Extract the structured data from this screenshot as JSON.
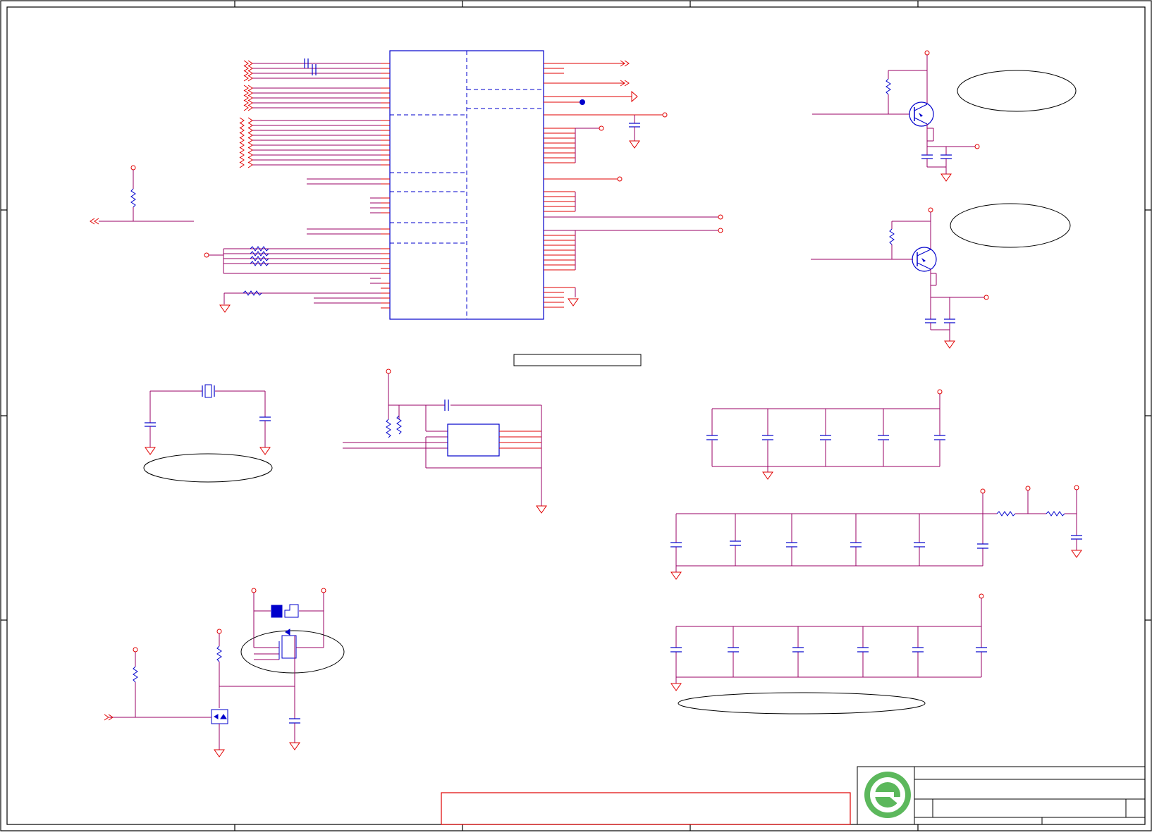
{
  "sheet": {
    "colors": {
      "frame": "#000000",
      "wire": "#990066",
      "pin": "#e00000",
      "part": "#0000cc",
      "dashed": "#0000cc",
      "logo_green": "#5cb85c",
      "title_box": "#e00000"
    },
    "title_block": {
      "logo": "company-logo-green-e"
    }
  }
}
